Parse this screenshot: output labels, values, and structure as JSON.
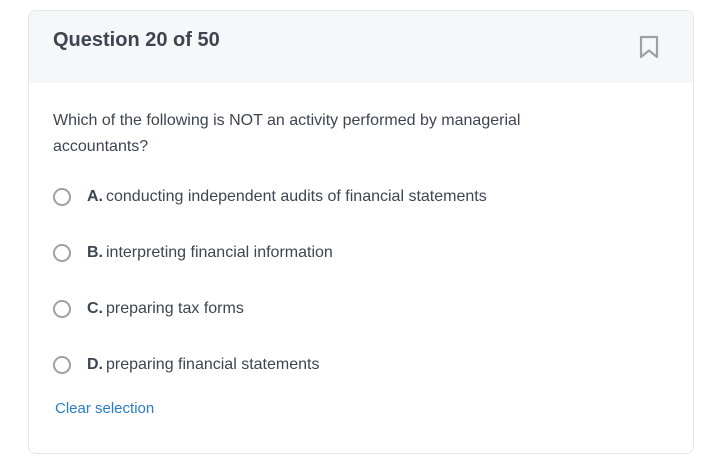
{
  "question": {
    "title": "Question 20 of 50",
    "bookmark_icon": "bookmark-icon",
    "text": "Which of the following is NOT an activity performed by managerial accountants?"
  },
  "options": [
    {
      "letter": "A.",
      "text": "conducting independent audits of financial statements",
      "selected": false
    },
    {
      "letter": "B.",
      "text": "interpreting financial information",
      "selected": false
    },
    {
      "letter": "C.",
      "text": "preparing tax forms",
      "selected": false
    },
    {
      "letter": "D.",
      "text": "preparing financial statements",
      "selected": false
    }
  ],
  "clear_selection_label": "Clear selection",
  "colors": {
    "text": "#3d4551",
    "header_bg": "#f6f7f8",
    "link": "#2a7bc8",
    "radio_border": "#9aa1a9"
  }
}
